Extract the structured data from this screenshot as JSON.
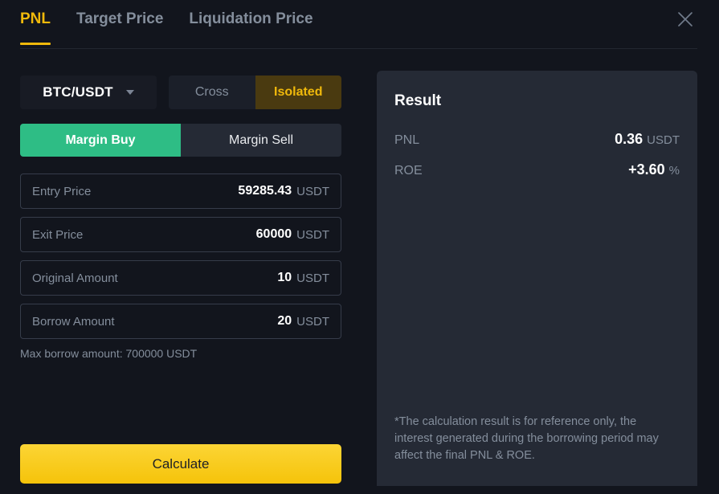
{
  "header": {
    "tabs": [
      {
        "label": "PNL",
        "active": true
      },
      {
        "label": "Target Price",
        "active": false
      },
      {
        "label": "Liquidation Price",
        "active": false
      }
    ],
    "close_icon": "close-icon"
  },
  "calculator": {
    "pair": {
      "label": "BTC/USDT",
      "caret_icon": "chevron-down-icon"
    },
    "margin_mode": {
      "options": [
        "Cross",
        "Isolated"
      ],
      "selected": "Isolated"
    },
    "side": {
      "options": [
        "Margin Buy",
        "Margin Sell"
      ],
      "selected": "Margin Buy"
    },
    "fields": [
      {
        "label": "Entry Price",
        "value": "59285.43",
        "unit": "USDT"
      },
      {
        "label": "Exit Price",
        "value": "60000",
        "unit": "USDT"
      },
      {
        "label": "Original Amount",
        "value": "10",
        "unit": "USDT"
      },
      {
        "label": "Borrow Amount",
        "value": "20",
        "unit": "USDT"
      }
    ],
    "max_borrow_note": "Max borrow amount: 700000 USDT",
    "calculate_label": "Calculate"
  },
  "result": {
    "title": "Result",
    "rows": [
      {
        "key": "PNL",
        "value": "0.36",
        "unit": "USDT"
      },
      {
        "key": "ROE",
        "value": "+3.60",
        "unit": "%"
      }
    ],
    "disclaimer": "*The calculation result is for reference only, the interest generated during the borrowing period may affect the final PNL & ROE."
  },
  "colors": {
    "page_bg": "#12151d",
    "panel_bg": "#252a35",
    "accent_gold": "#f0b90b",
    "accent_gold_dim": "#4a3a10",
    "buy_green": "#2ebd85",
    "muted_text": "#848e9c",
    "button_gold": "#fcd535"
  }
}
